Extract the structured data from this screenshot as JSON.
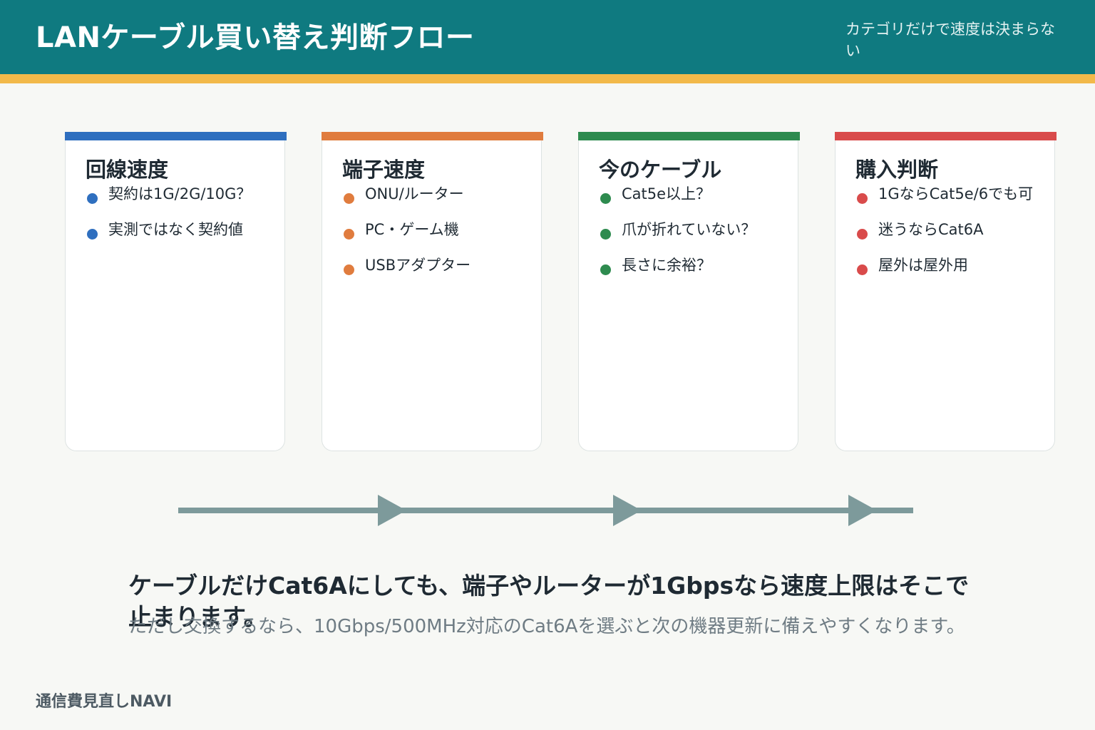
{
  "header": {
    "title": "LANケーブル買い替え判断フロー",
    "subtitle": "カテゴリだけで速度は決まらない"
  },
  "colors": {
    "header": "#0f7a80",
    "stripe": "#f2b94a",
    "arrow": "#7d9a9b"
  },
  "cards": [
    {
      "title": "回線速度",
      "color": "#2f6fbf",
      "items": [
        "契約は1G/2G/10G？",
        "実測ではなく契約値"
      ]
    },
    {
      "title": "端子速度",
      "color": "#e07c3e",
      "items": [
        "ONU/ルーター",
        "PC・ゲーム機",
        "USBアダプター"
      ]
    },
    {
      "title": "今のケーブル",
      "color": "#2e8b4f",
      "items": [
        "Cat5e以上？",
        "爪が折れていない？",
        "長さに余裕？"
      ]
    },
    {
      "title": "購入判断",
      "color": "#d94b4b",
      "items": [
        "1GならCat5e/6でも可",
        "迷うならCat6A",
        "屋外は屋外用"
      ]
    }
  ],
  "conclusion": "ケーブルだけCat6Aにしても、端子やルーターが1Gbpsなら速度上限はそこで止まります。",
  "note": "ただし交換するなら、10Gbps/500MHz対応のCat6Aを選ぶと次の機器更新に備えやすくなります。",
  "footer": "通信費見直しNAVI"
}
